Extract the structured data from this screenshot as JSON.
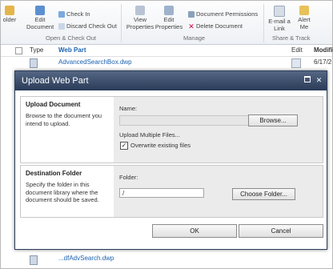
{
  "ribbon": {
    "new_folder_label": "older",
    "edit_document_label": "Edit Document",
    "check_in_label": "Check In",
    "discard_checkout_label": "Discard Check Out",
    "view_properties_label": "View Properties",
    "edit_properties_label": "Edit Properties",
    "document_permissions_label": "Document Permissions",
    "delete_document_label": "Delete Document",
    "email_link_label": "E-mail a Link",
    "alert_me_label": "Alert Me",
    "group_open_checkout": "Open & Check Out",
    "group_manage": "Manage",
    "group_share_track": "Share & Track"
  },
  "list": {
    "header_type": "Type",
    "header_name": "Web Part",
    "header_edit": "Edit",
    "header_modified": "Modifie",
    "row_name": "AdvancedSearchBox.dwp",
    "row_modified": "6/17/2",
    "bottom_row_name": "...dfAdvSearch.dwp"
  },
  "dialog": {
    "title": "Upload Web Part",
    "upload_section": {
      "title": "Upload Document",
      "description": "Browse to the document you intend to upload.",
      "name_label": "Name:",
      "browse_label": "Browse...",
      "upload_multiple_label": "Upload Multiple Files...",
      "overwrite_label": "Overwrite existing files",
      "overwrite_checked": "✓"
    },
    "destination_section": {
      "title": "Destination Folder",
      "description": "Specify the folder in this document library where the document should be saved.",
      "folder_label": "Folder:",
      "folder_value": "/",
      "choose_folder_label": "Choose Folder..."
    },
    "ok_label": "OK",
    "cancel_label": "Cancel"
  },
  "colors": {
    "titlebar": "#2a3b57",
    "link": "#1b61b2"
  }
}
